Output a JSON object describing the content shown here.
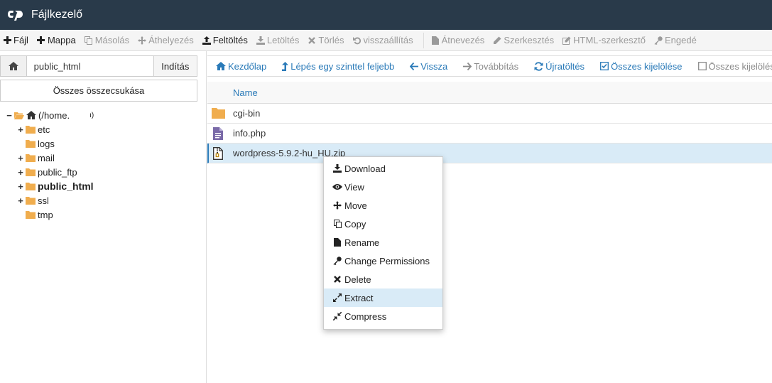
{
  "app": {
    "title": "Fájlkezelő"
  },
  "toolbar": [
    {
      "label": "Fájl",
      "icon": "plus-icon",
      "enabled": true
    },
    {
      "label": "Mappa",
      "icon": "plus-icon",
      "enabled": true
    },
    {
      "label": "Másolás",
      "icon": "copy-icon",
      "enabled": false
    },
    {
      "label": "Áthelyezés",
      "icon": "move-icon",
      "enabled": false
    },
    {
      "label": "Feltöltés",
      "icon": "upload-icon",
      "enabled": true
    },
    {
      "label": "Letöltés",
      "icon": "download-icon",
      "enabled": false
    },
    {
      "label": "Törlés",
      "icon": "close-icon",
      "enabled": false
    },
    {
      "label": "visszaállítás",
      "icon": "undo-icon",
      "enabled": false
    },
    {
      "label": "Átnevezés",
      "icon": "file-icon",
      "enabled": false
    },
    {
      "label": "Szerkesztés",
      "icon": "pencil-icon",
      "enabled": false
    },
    {
      "label": "HTML-szerkesztő",
      "icon": "edit-square-icon",
      "enabled": false
    },
    {
      "label": "Engedé",
      "icon": "key-icon",
      "enabled": false
    }
  ],
  "pathbar": {
    "value": "public_html",
    "go_label": "Indítás"
  },
  "collapse_label": "Összes összecsukása",
  "tree": [
    {
      "label": "(/home.",
      "suffix": "ı)",
      "toggle": "−",
      "root": true
    },
    {
      "label": "etc",
      "toggle": "+"
    },
    {
      "label": "logs",
      "toggle": ""
    },
    {
      "label": "mail",
      "toggle": "+"
    },
    {
      "label": "public_ftp",
      "toggle": "+"
    },
    {
      "label": "public_html",
      "toggle": "+",
      "bold": true
    },
    {
      "label": "ssl",
      "toggle": "+"
    },
    {
      "label": "tmp",
      "toggle": ""
    }
  ],
  "navbar": [
    {
      "label": "Kezdőlap",
      "icon": "home-icon",
      "enabled": true
    },
    {
      "label": "Lépés egy szinttel feljebb",
      "icon": "level-up-icon",
      "enabled": true
    },
    {
      "label": "Vissza",
      "icon": "arrow-left-icon",
      "enabled": true
    },
    {
      "label": "Továbbítás",
      "icon": "arrow-right-icon",
      "enabled": false
    },
    {
      "label": "Újratöltés",
      "icon": "refresh-icon",
      "enabled": true
    },
    {
      "label": "Összes kijelölése",
      "icon": "checkbox-checked-icon",
      "enabled": true
    },
    {
      "label": "Összes kijelölés",
      "icon": "checkbox-empty-icon",
      "enabled": false
    }
  ],
  "table": {
    "header": "Name",
    "rows": [
      {
        "name": "cgi-bin",
        "icon": "folder-icon"
      },
      {
        "name": "info.php",
        "icon": "php-file-icon"
      },
      {
        "name": "wordpress-5.9.2-hu_HU.zip",
        "icon": "zip-file-icon",
        "selected": true
      }
    ]
  },
  "context_menu": [
    {
      "label": "Download",
      "icon": "download-icon"
    },
    {
      "label": "View",
      "icon": "eye-icon"
    },
    {
      "label": "Move",
      "icon": "move-icon"
    },
    {
      "label": "Copy",
      "icon": "copy-icon"
    },
    {
      "label": "Rename",
      "icon": "file-icon"
    },
    {
      "label": "Change Permissions",
      "icon": "key-icon"
    },
    {
      "label": "Delete",
      "icon": "close-icon"
    },
    {
      "label": "Extract",
      "icon": "expand-icon",
      "hover": true
    },
    {
      "label": "Compress",
      "icon": "compress-icon"
    }
  ],
  "colors": {
    "header_bg": "#293a4a",
    "link_blue": "#2a7ab8",
    "folder": "#f0ad4e",
    "selected_row": "#d9ebf7",
    "php_icon": "#7a6aa8"
  }
}
